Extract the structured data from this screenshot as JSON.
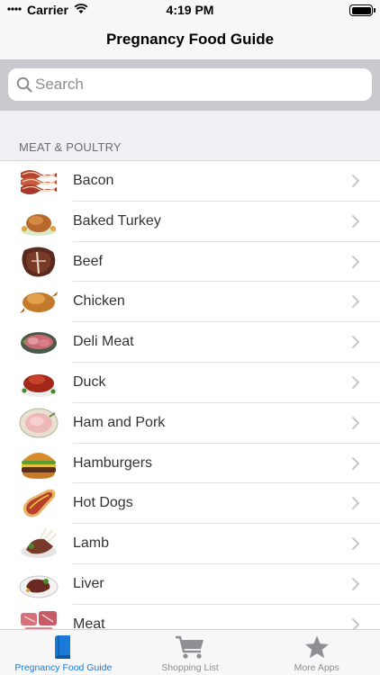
{
  "status_bar": {
    "carrier": "Carrier",
    "time": "4:19 PM"
  },
  "nav": {
    "title": "Pregnancy Food Guide"
  },
  "search": {
    "placeholder": "Search"
  },
  "section": {
    "title": "MEAT & POULTRY"
  },
  "items": [
    {
      "label": "Bacon",
      "icon": "bacon-icon"
    },
    {
      "label": "Baked Turkey",
      "icon": "turkey-icon"
    },
    {
      "label": "Beef",
      "icon": "beef-icon"
    },
    {
      "label": "Chicken",
      "icon": "chicken-icon"
    },
    {
      "label": "Deli Meat",
      "icon": "deli-meat-icon"
    },
    {
      "label": "Duck",
      "icon": "duck-icon"
    },
    {
      "label": "Ham and Pork",
      "icon": "ham-icon"
    },
    {
      "label": "Hamburgers",
      "icon": "hamburger-icon"
    },
    {
      "label": "Hot Dogs",
      "icon": "hot-dog-icon"
    },
    {
      "label": "Lamb",
      "icon": "lamb-icon"
    },
    {
      "label": "Liver",
      "icon": "liver-icon"
    },
    {
      "label": "Meat",
      "icon": "meat-icon"
    }
  ],
  "tabs": [
    {
      "label": "Pregnancy Food Guide",
      "icon": "book-icon",
      "active": true
    },
    {
      "label": "Shopping List",
      "icon": "cart-icon",
      "active": false
    },
    {
      "label": "More Apps",
      "icon": "star-icon",
      "active": false
    }
  ],
  "colors": {
    "accent": "#1a7ad8",
    "inactive": "#8e8e93",
    "search_bg": "#c9c9ce"
  }
}
